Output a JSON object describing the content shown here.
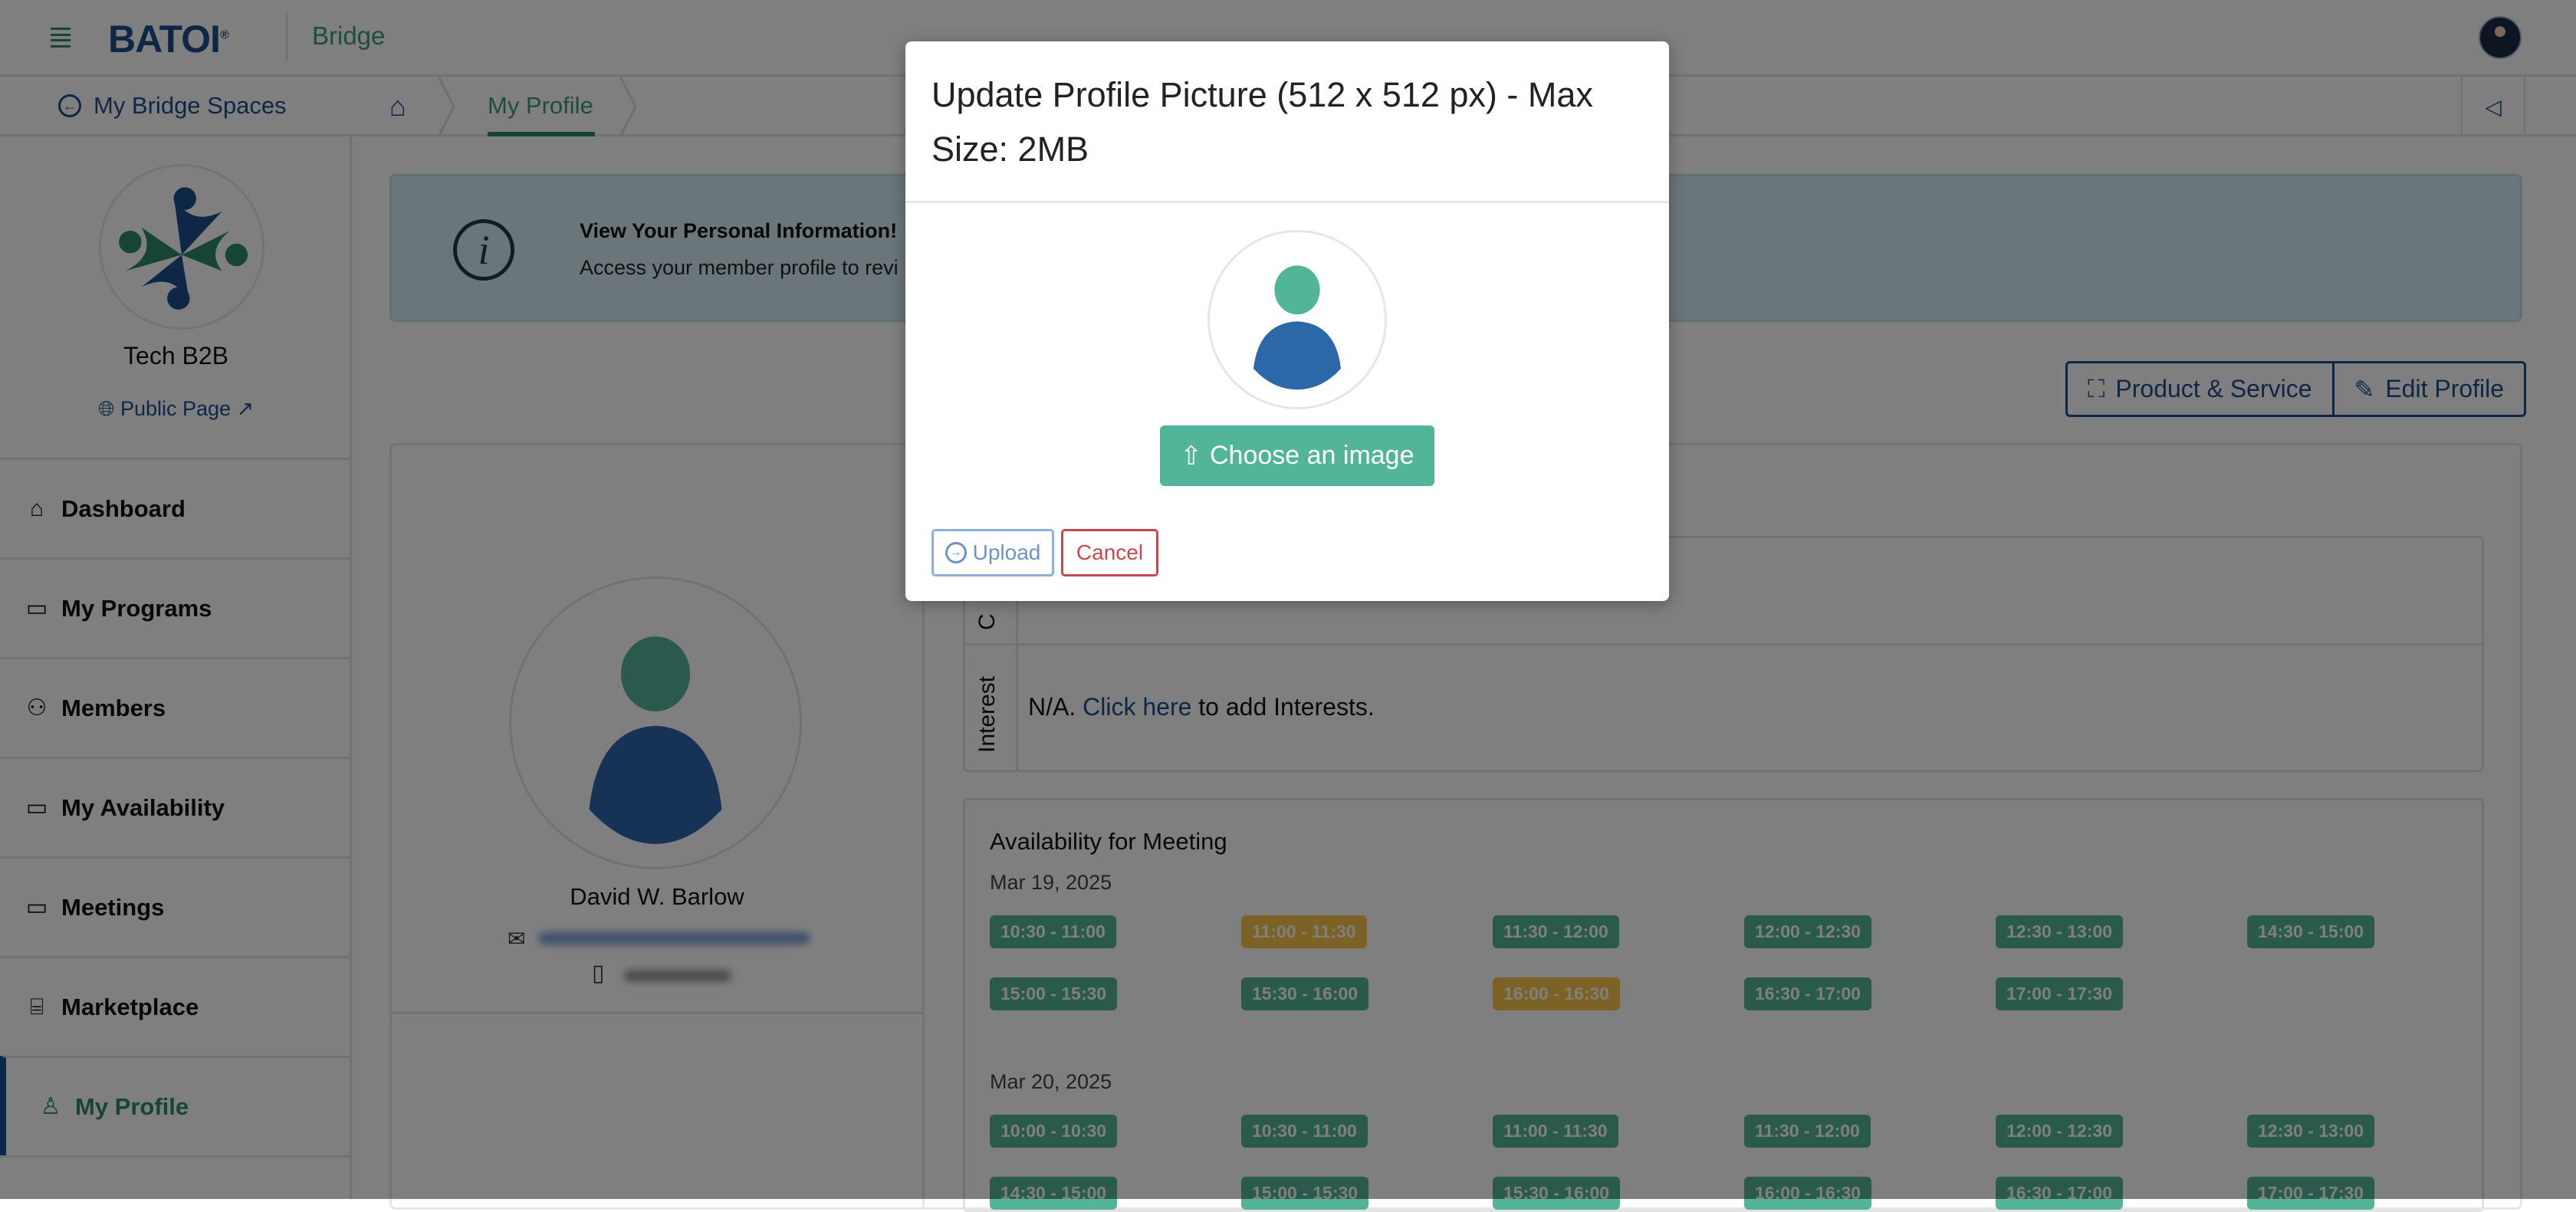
{
  "header": {
    "logo": "BATOI",
    "product": "Bridge",
    "menu_icon": "hamburger-icon",
    "avatar": "user-avatar"
  },
  "subbar": {
    "back_label": "My Bridge Spaces",
    "breadcrumb": {
      "home_icon": "home-icon",
      "current": "My Profile"
    },
    "collapse_icon": "chevron-left-icon"
  },
  "sidebar": {
    "org_name": "Tech B2B",
    "public_page": "Public Page",
    "items": [
      {
        "label": "Dashboard",
        "icon": "home-icon",
        "glyph": "⌂"
      },
      {
        "label": "My Programs",
        "icon": "calendar-icon",
        "glyph": "▭"
      },
      {
        "label": "Members",
        "icon": "users-icon",
        "glyph": "⚇"
      },
      {
        "label": "My Availability",
        "icon": "calendar-icon",
        "glyph": "▭"
      },
      {
        "label": "Meetings",
        "icon": "calendar-icon",
        "glyph": "▭"
      },
      {
        "label": "Marketplace",
        "icon": "store-icon",
        "glyph": "⌸"
      },
      {
        "label": "My Profile",
        "icon": "user-icon",
        "glyph": "♙",
        "active": true
      }
    ]
  },
  "banner": {
    "title": "View Your Personal Information!",
    "subtitle": "Access your member profile to revi"
  },
  "actions": {
    "product_service": "Product & Service",
    "edit_profile": "Edit Profile"
  },
  "profile": {
    "name": "David W. Barlow"
  },
  "details": {
    "interest_label": "Interest",
    "interest_prefix": "N/A.",
    "interest_link": "Click here",
    "interest_suffix": "to add Interests.",
    "row1_label": "C"
  },
  "availability": {
    "title": "Availability for Meeting",
    "days": [
      {
        "date": "Mar 19, 2025",
        "slots": [
          {
            "t": "10:30 - 11:00",
            "s": "available"
          },
          {
            "t": "11:00 - 11:30",
            "s": "booked"
          },
          {
            "t": "11:30 - 12:00",
            "s": "available"
          },
          {
            "t": "12:00 - 12:30",
            "s": "available"
          },
          {
            "t": "12:30 - 13:00",
            "s": "available"
          },
          {
            "t": "14:30 - 15:00",
            "s": "available"
          },
          {
            "t": "15:00 - 15:30",
            "s": "available"
          },
          {
            "t": "15:30 - 16:00",
            "s": "available"
          },
          {
            "t": "16:00 - 16:30",
            "s": "booked"
          },
          {
            "t": "16:30 - 17:00",
            "s": "available"
          },
          {
            "t": "17:00 - 17:30",
            "s": "available"
          }
        ]
      },
      {
        "date": "Mar 20, 2025",
        "slots": [
          {
            "t": "10:00 - 10:30",
            "s": "available"
          },
          {
            "t": "10:30 - 11:00",
            "s": "available"
          },
          {
            "t": "11:00 - 11:30",
            "s": "available"
          },
          {
            "t": "11:30 - 12:00",
            "s": "available"
          },
          {
            "t": "12:00 - 12:30",
            "s": "available"
          },
          {
            "t": "12:30 - 13:00",
            "s": "available"
          },
          {
            "t": "14:30 - 15:00",
            "s": "available"
          },
          {
            "t": "15:00 - 15:30",
            "s": "available"
          },
          {
            "t": "15:30 - 16:00",
            "s": "available"
          },
          {
            "t": "16:00 - 16:30",
            "s": "available"
          },
          {
            "t": "16:30 - 17:00",
            "s": "available"
          },
          {
            "t": "17:00 - 17:30",
            "s": "available"
          }
        ]
      }
    ]
  },
  "colors": {
    "available": "#54b498",
    "booked": "#f8c44a",
    "brand_blue": "#1f4e8c",
    "brand_green": "#2f8a6a"
  },
  "modal": {
    "title": "Update Profile Picture (512 x 512 px) - Max Size: 2MB",
    "choose": "Choose an image",
    "upload": "Upload",
    "cancel": "Cancel"
  }
}
